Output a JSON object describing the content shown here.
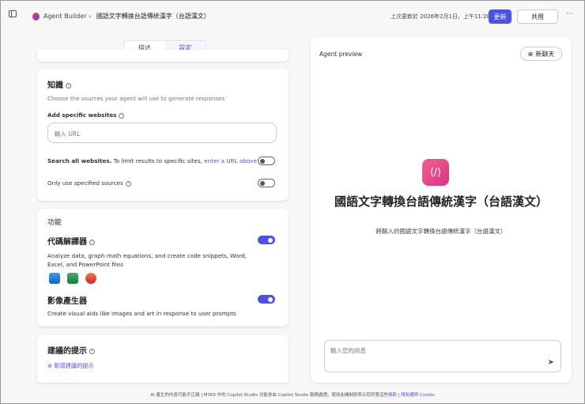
{
  "header": {
    "app": "Agent Builder",
    "agent_name": "國語文字轉換台語傳統漢字（台語漢文）",
    "last_updated": "上次更新於 2026年2月1日，上午11:28:33",
    "publish": "更新",
    "share": "共用",
    "more": "···"
  },
  "tabs": [
    {
      "label": "描述"
    },
    {
      "label": "設定"
    }
  ],
  "knowledge": {
    "title": "知識",
    "subtitle": "Choose the sources your agent will use to generate responses",
    "add_websites": "Add specific websites",
    "url_placeholder": "輸入 URL",
    "search_all_bold": "Search all websites.",
    "search_all_rest": " To limit results to specific sites, ",
    "search_all_link": "enter a URL above",
    "only_specified": "Only use specified sources",
    "search_all_on": false,
    "only_specified_on": false
  },
  "capabilities": {
    "title": "功能",
    "code_title": "代碼解譯器",
    "code_desc": "Analyze data, graph math equations, and create code snippets, Word, Excel, and PowerPoint files",
    "code_on": true,
    "image_title": "影像產生器",
    "image_desc": "Create visual aids like images and art in response to user prompts",
    "image_on": true
  },
  "prompts": {
    "title": "建議的提示",
    "add": "新增建議的提示"
  },
  "preview": {
    "label": "Agent preview",
    "new_chat": "新聊天",
    "title": "國語文字轉換台語傳統漢字（台語漢文）",
    "desc": "將輸入的國語文字轉換台語傳統漢字（台語漢文）",
    "msg_placeholder": "輸入您的訊息"
  },
  "footer": {
    "text": "AI 產生的內容可能不正確 | M365 中的 Copilot Studio 功能會由 Copilot Studio 服務處理。使用此機制即表示您同意這些",
    "terms": "條款",
    "sep": " | ",
    "privacy": "隱私權與 Cookie"
  }
}
